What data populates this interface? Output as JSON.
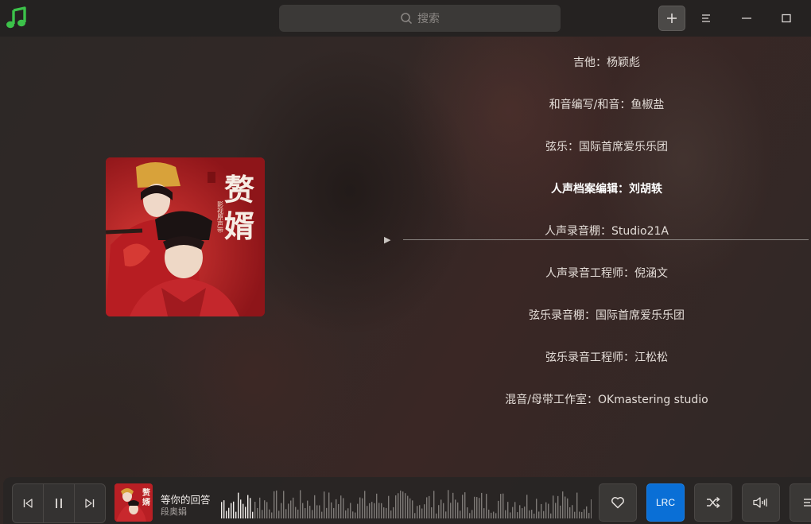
{
  "header": {
    "search_placeholder": "搜索",
    "icons": [
      "music-logo-icon",
      "search-icon",
      "plus-icon",
      "menu-icon",
      "minimize-icon",
      "maximize-icon"
    ]
  },
  "album": {
    "cover_title": "赘婿",
    "cover_subtitle": "影视原声带"
  },
  "lyrics": [
    {
      "text": "吉他：杨颖彪",
      "active": false
    },
    {
      "text": "和音编写/和音：鱼椒盐",
      "active": false
    },
    {
      "text": "弦乐：国际首席爱乐乐团",
      "active": false
    },
    {
      "text": "人声档案编辑：刘胡轶",
      "active": true
    },
    {
      "text": "人声录音棚：Studio21A",
      "active": false
    },
    {
      "text": "人声录音工程师：倪涵文",
      "active": false
    },
    {
      "text": "弦乐录音棚：国际首席爱乐乐团",
      "active": false
    },
    {
      "text": "弦乐录音工程师：江松松",
      "active": false
    },
    {
      "text": "混音/母带工作室：OKmastering studio",
      "active": false
    }
  ],
  "player": {
    "song_title": "等你的回答",
    "artist": "段奥娟",
    "lrc_label": "LRC",
    "state": "playing",
    "accent_color": "#0a6fd6"
  }
}
